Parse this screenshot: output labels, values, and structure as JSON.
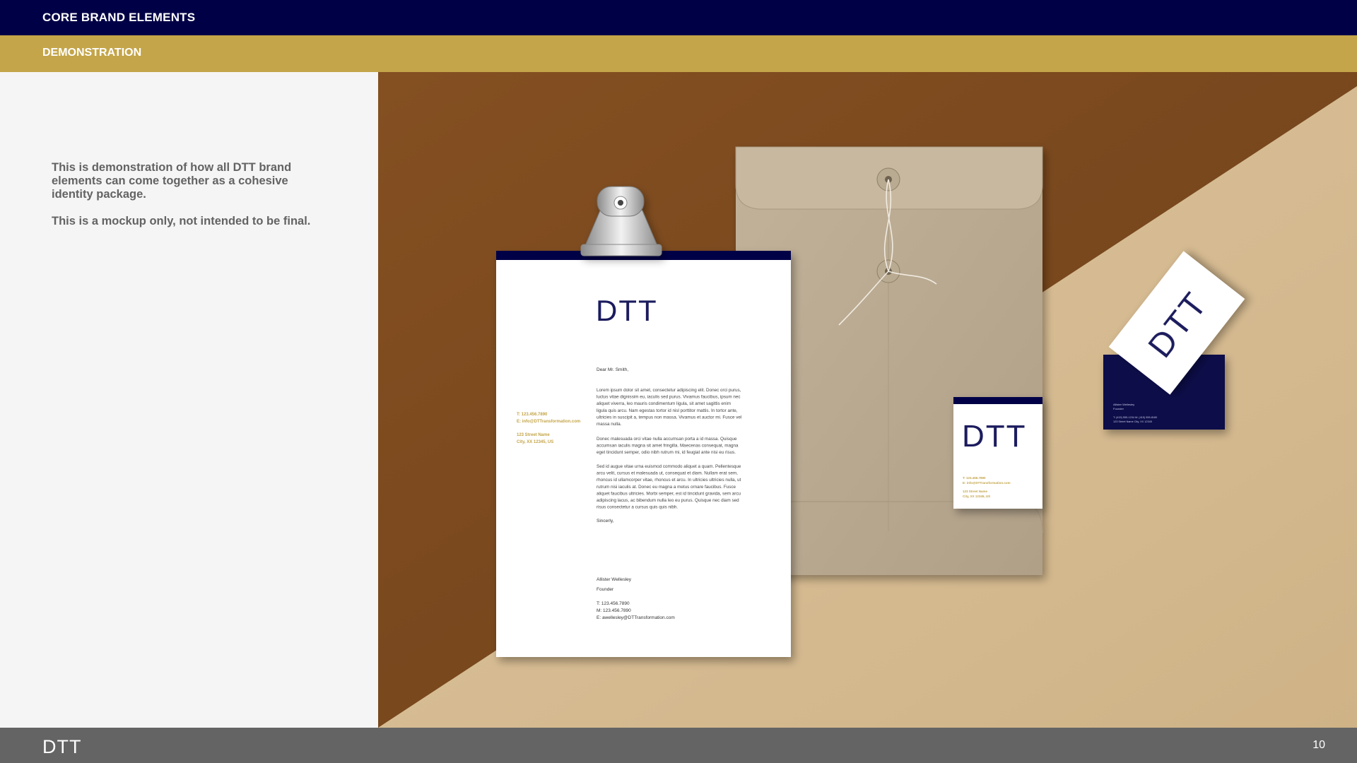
{
  "header": {
    "section_title": "CORE BRAND ELEMENTS",
    "subsection_title": "DEMONSTRATION"
  },
  "intro": {
    "paragraph_1": "This is demonstration of how all DTT brand elements can come together as a cohesive identity package.",
    "paragraph_2": "This is a mockup only, not intended to be final."
  },
  "mockup": {
    "brand_mark": "DTT",
    "letterhead": {
      "contact_phone": "T:  123.456.7890",
      "contact_email": "E:  info@DTTransformation.com",
      "address_street": "123 Street Name",
      "address_city": "City, XX 12345, US",
      "salutation": "Dear Mr. Smith,",
      "body_paragraph_1": [
        "Lorem ipsum dolor sit amet, consectetur adipiscing elit. Donec orci purus,",
        "luctus vitae dignissim eu, iaculis sed purus. Vivamus faucibus, ipsum nec",
        "aliquet viverra, leo mauris condimentum ligula, sit amet sagittis enim",
        "ligula quis arcu. Nam egestas tortor id nisl porttitor mattis. In tortor ante,",
        "ultricies in suscipit a, tempus non massa. Vivamus et auctor mi. Fusce vel",
        "massa nulla."
      ],
      "body_paragraph_2": [
        "Donec malesuada orci vitae nulla accumsan porta a id massa. Quisque",
        "accumsan iaculis magna sit amet fringilla. Maecenas consequat, magna",
        "eget tincidunt semper, odio nibh rutrum mi, id feugiat ante nisi eu risus."
      ],
      "body_paragraph_3": [
        "Sed id augue vitae urna euismod commodo aliquet a quam. Pellentesque",
        "arcu velit, cursus et malesuada ut, consequat et diam. Nullam erat sem,",
        "rhoncus id ullamcorper vitae, rhoncus et arcu. In ultricies ultricies nulla, ut",
        "rutrum nisi iaculis at. Donec eu magna a metus ornare faucibus. Fusce",
        "aliquet faucibus ultricies. Morbi semper, est id tincidunt gravida, sem arcu",
        "adipiscing lacus, ac bibendum nulla leo eu purus. Quisque nec diam sed",
        "risus consectetur a cursus quis quis nibh."
      ],
      "closing": "Sincerly,",
      "signatory_name": "Allister Wellesley",
      "signatory_title": "Founder",
      "signatory_phone": "T:  123.456.7890",
      "signatory_mobile": "M: 123.456.7890",
      "signatory_email": "E:  awellesley@DTTransformation.com"
    },
    "envelope_label": {
      "contact_phone": "T:  123.456.7890",
      "contact_email": "E:  info@DTTransformation.com",
      "address_street": "123 Street Name",
      "address_city": "City, XX 12345, US"
    }
  },
  "footer": {
    "logo_text": "DTT",
    "page_number": "10"
  },
  "colors": {
    "navy": "#000046",
    "gold": "#c4a549",
    "footer_gray": "#646464",
    "panel_bg": "#f5f5f5",
    "intro_text": "#636363"
  }
}
